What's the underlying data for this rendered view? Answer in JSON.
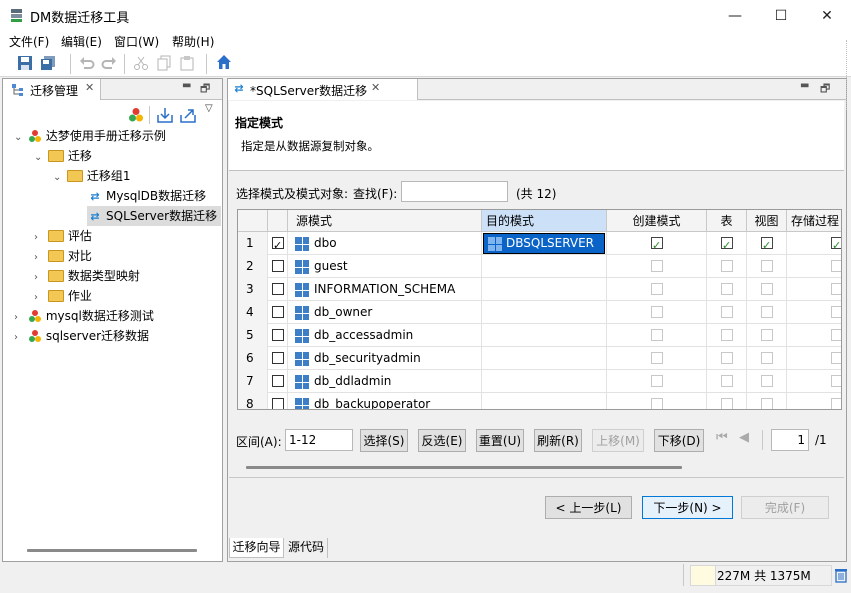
{
  "window": {
    "title": "DM数据迁移工具",
    "minimize": "—",
    "maximize": "☐",
    "close": "✕"
  },
  "menu": [
    "文件(F)",
    "编辑(E)",
    "窗口(W)",
    "帮助(H)"
  ],
  "left_view": {
    "tab_label": "迁移管理",
    "tree": [
      {
        "label": "达梦使用手册迁移示例"
      },
      {
        "label": "迁移"
      },
      {
        "label": "迁移组1"
      },
      {
        "label": "MysqlDB数据迁移"
      },
      {
        "label": "SQLServer数据迁移"
      },
      {
        "label": "评估"
      },
      {
        "label": "对比"
      },
      {
        "label": "数据类型映射"
      },
      {
        "label": "作业"
      },
      {
        "label": "mysql数据迁移测试"
      },
      {
        "label": "sqlserver迁移数据"
      }
    ]
  },
  "editor": {
    "tab_label": "*SQLServer数据迁移",
    "heading": "指定模式",
    "description": "指定是从数据源复制对象。",
    "select_label": "选择模式及模式对象:",
    "find_label": "查找(F):",
    "find_value": "",
    "count_text": "(共 12)",
    "columns": [
      "源模式",
      "目的模式",
      "创建模式",
      "表",
      "视图",
      "存储过程"
    ],
    "rows": [
      {
        "num": "1",
        "checked": true,
        "src": "dbo",
        "dest": "DBSQLSERVER",
        "create": true,
        "table": true,
        "view": true,
        "proc": true
      },
      {
        "num": "2",
        "checked": false,
        "src": "guest",
        "dest": "",
        "create": false,
        "table": false,
        "view": false,
        "proc": false
      },
      {
        "num": "3",
        "checked": false,
        "src": "INFORMATION_SCHEMA",
        "dest": "",
        "create": false,
        "table": false,
        "view": false,
        "proc": false
      },
      {
        "num": "4",
        "checked": false,
        "src": "db_owner",
        "dest": "",
        "create": false,
        "table": false,
        "view": false,
        "proc": false
      },
      {
        "num": "5",
        "checked": false,
        "src": "db_accessadmin",
        "dest": "",
        "create": false,
        "table": false,
        "view": false,
        "proc": false
      },
      {
        "num": "6",
        "checked": false,
        "src": "db_securityadmin",
        "dest": "",
        "create": false,
        "table": false,
        "view": false,
        "proc": false
      },
      {
        "num": "7",
        "checked": false,
        "src": "db_ddladmin",
        "dest": "",
        "create": false,
        "table": false,
        "view": false,
        "proc": false
      },
      {
        "num": "8",
        "checked": false,
        "src": "db_backupoperator",
        "dest": "",
        "create": false,
        "table": false,
        "view": false,
        "proc": false
      }
    ],
    "range_label": "区间(A):",
    "range_value": "1-12",
    "buttons": {
      "select": "选择(S)",
      "invert": "反选(E)",
      "reset": "重置(U)",
      "refresh": "刷新(R)",
      "move_up": "上移(M)",
      "move_down": "下移(D)"
    },
    "page_value": "1",
    "page_total": "/1",
    "prev_button": "< 上一步(L)",
    "next_button": "下一步(N) >",
    "finish_button": "完成(F)",
    "bottom_tabs": [
      "迁移向导",
      "源代码"
    ]
  },
  "status": {
    "memory": "227M 共 1375M"
  }
}
